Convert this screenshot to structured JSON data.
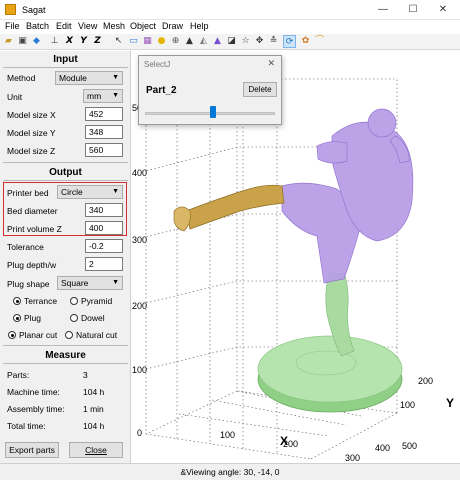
{
  "window": {
    "title": "Sagat",
    "minimize": "—",
    "maximize": "☐",
    "close": "✕"
  },
  "menu": [
    "File",
    "Batch",
    "Edit",
    "View",
    "Mesh",
    "Object",
    "Draw",
    "Help"
  ],
  "input": {
    "heading": "Input",
    "method_label": "Method",
    "method_value": "Module",
    "unit_label": "Unit",
    "unit_value": "mm",
    "size_x_label": "Model size X",
    "size_x": "452",
    "size_y_label": "Model size Y",
    "size_y": "348",
    "size_z_label": "Model size Z",
    "size_z": "560"
  },
  "output": {
    "heading": "Output",
    "printer_bed_label": "Printer bed",
    "printer_bed_value": "Circle",
    "bed_diameter_label": "Bed diameter",
    "bed_diameter": "340",
    "print_volume_label": "Print volume Z",
    "print_volume": "400",
    "tolerance_label": "Tolerance",
    "tolerance": "-0.2",
    "plug_depth_label": "Plug depth/w",
    "plug_depth": "2",
    "plug_shape_label": "Plug shape",
    "plug_shape_value": "Square",
    "radio_terrance": "Terrance",
    "radio_pyramid": "Pyramid",
    "radio_plug": "Plug",
    "radio_dowel": "Dowel",
    "radio_planar": "Planar cut",
    "radio_natural": "Natural cut"
  },
  "measure": {
    "heading": "Measure",
    "parts_label": "Parts:",
    "parts": "3",
    "machine_label": "Machine time:",
    "machine": "104 h",
    "assembly_label": "Assembly time:",
    "assembly": "1 min",
    "total_label": "Total time:",
    "total": "104 h"
  },
  "buttons": {
    "export": "Export parts",
    "close": "Close"
  },
  "dialog": {
    "title": "SelectJ",
    "part": "Part_2",
    "delete": "Delete",
    "slider_fraction": 0.52
  },
  "axes": {
    "x_title": "X",
    "y_title": "Y",
    "x_ticks": [
      "100",
      "200",
      "300",
      "400",
      "500"
    ],
    "y_ticks": [
      "100",
      "200"
    ],
    "z_ticks": [
      "100",
      "200",
      "300",
      "400",
      "500"
    ],
    "z_floor": "0"
  },
  "status": {
    "text": "&Viewing angle: 30, -14, 0"
  },
  "colors": {
    "accent": "#0078d7",
    "highlight_box": "#d32f2f",
    "part_purple": "#9b6fd6",
    "part_gold": "#c9a24a",
    "part_green": "#a9dba0"
  }
}
